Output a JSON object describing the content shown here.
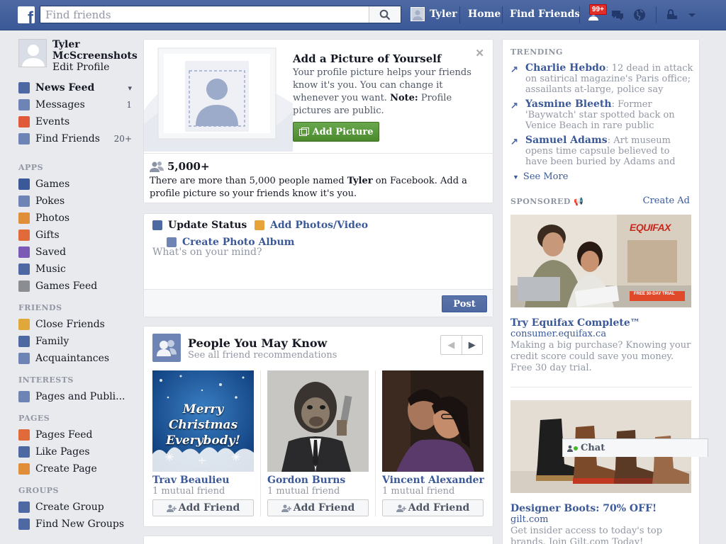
{
  "search": {
    "placeholder": "Find friends"
  },
  "topnav": {
    "user_name": "Tyler",
    "home": "Home",
    "find_friends": "Find Friends",
    "notif_badge": "99+"
  },
  "sidebar": {
    "profile_name": "Tyler McScreenshots",
    "edit_profile": "Edit Profile",
    "favorites": [
      {
        "label": "News Feed",
        "count": "",
        "icon_color": "#4e69a2"
      },
      {
        "label": "Messages",
        "count": "1",
        "icon_color": "#6d84b4"
      },
      {
        "label": "Events",
        "count": "",
        "icon_color": "#e05a3a"
      },
      {
        "label": "Find Friends",
        "count": "20+",
        "icon_color": "#6d84b4"
      }
    ],
    "apps_header": "APPS",
    "apps": [
      {
        "label": "Games",
        "icon_color": "#3b5998"
      },
      {
        "label": "Pokes",
        "icon_color": "#6d84b4"
      },
      {
        "label": "Photos",
        "icon_color": "#e08e3a"
      },
      {
        "label": "Gifts",
        "icon_color": "#e06a3a"
      },
      {
        "label": "Saved",
        "icon_color": "#7a5ab4"
      },
      {
        "label": "Music",
        "icon_color": "#4e69a2"
      },
      {
        "label": "Games Feed",
        "icon_color": "#8a8d91"
      }
    ],
    "friends_header": "FRIENDS",
    "friends": [
      {
        "label": "Close Friends",
        "icon_color": "#e0a83a"
      },
      {
        "label": "Family",
        "icon_color": "#4e69a2"
      },
      {
        "label": "Acquaintances",
        "icon_color": "#6d84b4"
      }
    ],
    "interests_header": "INTERESTS",
    "interests": [
      {
        "label": "Pages and Publi...",
        "icon_color": "#6d84b4"
      }
    ],
    "pages_header": "PAGES",
    "pages": [
      {
        "label": "Pages Feed",
        "icon_color": "#e06a3a"
      },
      {
        "label": "Like Pages",
        "icon_color": "#4e69a2"
      },
      {
        "label": "Create Page",
        "icon_color": "#e08e3a"
      }
    ],
    "groups_header": "GROUPS",
    "groups": [
      {
        "label": "Create Group",
        "icon_color": "#4e69a2"
      },
      {
        "label": "Find New Groups",
        "icon_color": "#4e69a2"
      }
    ]
  },
  "profile_picture_prompt": {
    "title": "Add a Picture of Yourself",
    "body_part1": "Your profile picture helps your friends know it's you. You can change it whenever you want. ",
    "note_label": "Note:",
    "body_part2": " Profile pictures are public.",
    "button": "Add Picture",
    "count": "5,000+",
    "note_part1": "There are more than 5,000 people named ",
    "note_name": "Tyler",
    "note_part2": " on Facebook. Add a profile picture so your friends know it's you."
  },
  "composer": {
    "update_status": "Update Status",
    "add_photos": "Add Photos/Video",
    "create_album": "Create Photo Album",
    "placeholder": "What's on your mind?",
    "post": "Post"
  },
  "pymk": {
    "title": "People You May Know",
    "subtitle": "See all friend recommendations",
    "people": [
      {
        "name": "Trav Beaulieu",
        "mutual": "1 mutual friend",
        "add": "Add Friend",
        "photo_text": "Merry Christmas Everybody!"
      },
      {
        "name": "Gordon Burns",
        "mutual": "1 mutual friend",
        "add": "Add Friend"
      },
      {
        "name": "Vincent Alexander ...",
        "mutual": "1 mutual friend",
        "add": "Add Friend"
      }
    ]
  },
  "trending": {
    "header": "TRENDING",
    "items": [
      {
        "topic": "Charlie Hebdo",
        "text": ": 12 dead in attack on satirical magazine's Paris office; assailants at-large, police say"
      },
      {
        "topic": "Yasmine Bleeth",
        "text": ": Former 'Baywatch' star spotted back on Venice Beach in rare public"
      },
      {
        "topic": "Samuel Adams",
        "text": ": Art museum opens time capsule believed to have been buried by Adams and"
      }
    ],
    "see_more": "See More"
  },
  "sponsored": {
    "header": "SPONSORED",
    "create_ad": "Create Ad",
    "ads": [
      {
        "title": "Try Equifax Complete™",
        "url": "consumer.equifax.ca",
        "text": "Making a big purchase? Knowing your credit score could save you money. Free 30 day trial.",
        "brand": "EQUIFAX",
        "badge": "FREE 30-DAY TRIAL"
      },
      {
        "title": "Designer Boots: 70% OFF!",
        "url": "gilt.com",
        "text": "Get insider access to today's top brands. Join Gilt.com Today!"
      }
    ]
  },
  "chat": {
    "label": "Chat"
  }
}
